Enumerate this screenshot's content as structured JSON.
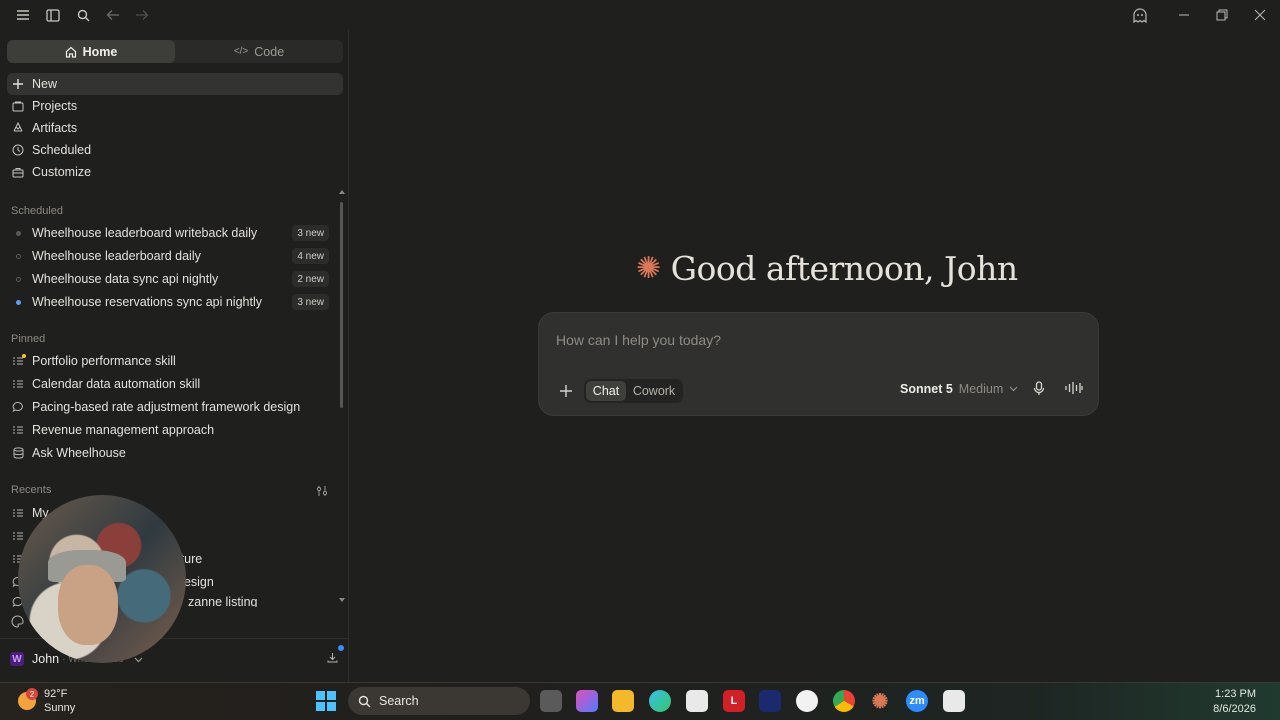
{
  "titlebar": {
    "icons": [
      "menu-icon",
      "sidebar-toggle-icon",
      "search-icon",
      "back-arrow-icon",
      "forward-arrow-icon"
    ],
    "right_icons": [
      "ghost-icon",
      "minimize-icon",
      "restore-icon",
      "close-icon"
    ]
  },
  "sidebar": {
    "tabs": [
      {
        "label": "Home",
        "active": true
      },
      {
        "label": "Code",
        "active": false
      }
    ],
    "nav": [
      {
        "label": "New",
        "icon": "plus-icon"
      },
      {
        "label": "Projects",
        "icon": "projects-icon"
      },
      {
        "label": "Artifacts",
        "icon": "artifacts-icon"
      },
      {
        "label": "Scheduled",
        "icon": "clock-icon"
      },
      {
        "label": "Customize",
        "icon": "briefcase-icon"
      }
    ],
    "scheduled_title": "Scheduled",
    "scheduled": [
      {
        "label": "Wheelhouse leaderboard writeback daily",
        "badge": "3 new",
        "status": "gray"
      },
      {
        "label": "Wheelhouse leaderboard daily",
        "badge": "4 new",
        "status": "hollow"
      },
      {
        "label": "Wheelhouse data sync api nightly",
        "badge": "2 new",
        "status": "hollow"
      },
      {
        "label": "Wheelhouse reservations sync api nightly",
        "badge": "3 new",
        "status": "blue"
      }
    ],
    "pinned_title": "Pinned",
    "pinned": [
      {
        "label": "Portfolio performance skill",
        "icon": "checklist-icon"
      },
      {
        "label": "Calendar data automation skill",
        "icon": "checklist-icon"
      },
      {
        "label": "Pacing-based rate adjustment framework design",
        "icon": "chat-bubble-icon"
      },
      {
        "label": "Revenue management approach",
        "icon": "checklist-icon"
      },
      {
        "label": "Ask Wheelhouse",
        "icon": "database-icon"
      }
    ],
    "recents_title": "Recents",
    "recents": [
      {
        "label": "My",
        "icon": "checklist-icon"
      },
      {
        "label": "",
        "icon": "checklist-icon"
      },
      {
        "label": "tecture",
        "icon": "checklist-icon"
      },
      {
        "label": "design",
        "icon": "chat-bubble-icon"
      },
      {
        "label": "zanne listing",
        "icon": "chat-bubble-icon"
      }
    ],
    "user": {
      "name": "John",
      "org": "· Wheelhouse",
      "initial": "W"
    }
  },
  "main": {
    "greeting": "Good afternoon, John",
    "composer": {
      "placeholder": "How can I help you today?",
      "modes": [
        {
          "label": "Chat",
          "active": true
        },
        {
          "label": "Cowork",
          "active": false
        }
      ],
      "model": "Sonnet 5",
      "effort": "Medium"
    }
  },
  "taskbar": {
    "weather_temp": "92°F",
    "weather_desc": "Sunny",
    "weather_badge": "2",
    "search_label": "Search",
    "time": "1:23 PM",
    "date": "8/6/2026"
  },
  "colors": {
    "accent": "#d97757",
    "background": "#1f1f1e",
    "composer": "#30302e",
    "windows_blue": "#4cc2ff"
  }
}
